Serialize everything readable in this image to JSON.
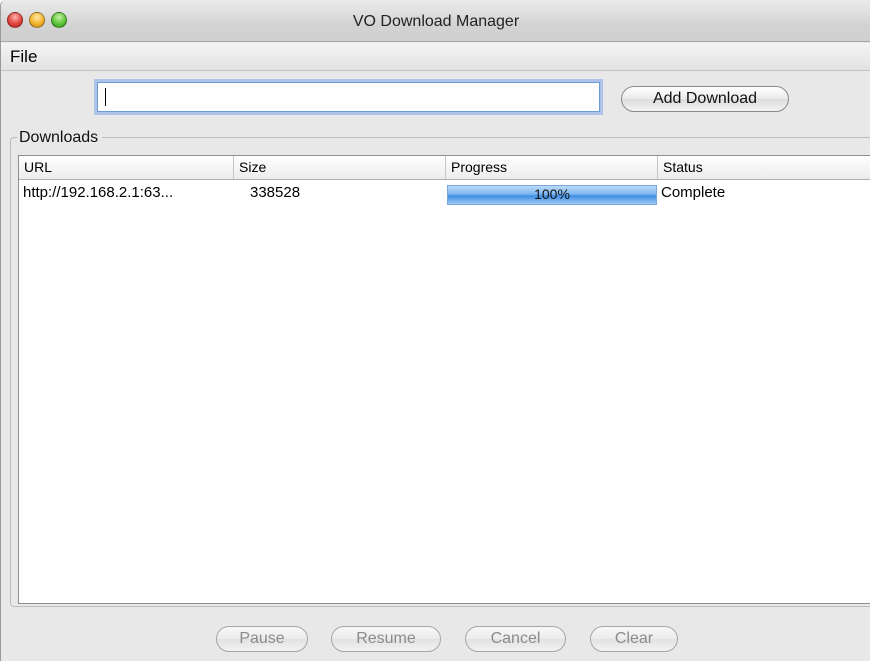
{
  "window": {
    "title": "VO Download Manager"
  },
  "menu": {
    "items": [
      "File"
    ]
  },
  "add_bar": {
    "url_value": "",
    "add_button_label": "Add Download"
  },
  "downloads": {
    "group_label": "Downloads",
    "columns": [
      "URL",
      "Size",
      "Progress",
      "Status"
    ],
    "rows": [
      {
        "url": "http://192.168.2.1:63...",
        "size": "338528",
        "progress_label": "100%",
        "progress_value": 1.0,
        "status": "Complete"
      }
    ]
  },
  "buttons": {
    "pause": "Pause",
    "resume": "Resume",
    "cancel": "Cancel",
    "clear": "Clear"
  },
  "colors": {
    "progress_fill": "#4a94e6",
    "focus_ring": "#78a5e6"
  }
}
